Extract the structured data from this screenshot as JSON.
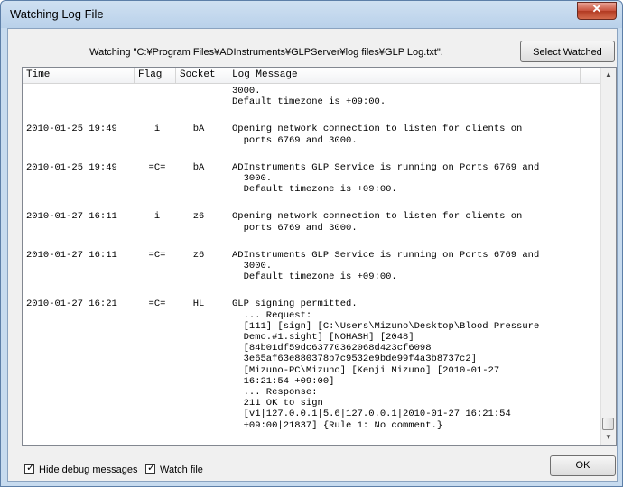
{
  "window": {
    "title": "Watching Log File",
    "close_glyph": "✕"
  },
  "watching_label": "Watching \"C:¥Program Files¥ADInstruments¥GLPServer¥log files¥GLP Log.txt\".",
  "select_button": "Select Watched File...",
  "columns": [
    "Time",
    "Flag",
    "Socket",
    "Log Message"
  ],
  "rows": [
    {
      "time": "",
      "flag": "",
      "socket": "",
      "message": [
        "3000.",
        "Default timezone is +09:00."
      ]
    },
    {
      "time": "2010-01-25 19:49",
      "flag": "i",
      "socket": "bA",
      "message": [
        "Opening network connection to listen for clients on",
        "  ports 6769 and 3000."
      ]
    },
    {
      "time": "2010-01-25 19:49",
      "flag": "=C=",
      "socket": "bA",
      "message": [
        "ADInstruments GLP Service is running on Ports 6769 and",
        "  3000.",
        "  Default timezone is +09:00."
      ]
    },
    {
      "time": "2010-01-27 16:11",
      "flag": "i",
      "socket": "z6",
      "message": [
        "Opening network connection to listen for clients on",
        "  ports 6769 and 3000."
      ]
    },
    {
      "time": "2010-01-27 16:11",
      "flag": "=C=",
      "socket": "z6",
      "message": [
        "ADInstruments GLP Service is running on Ports 6769 and",
        "  3000.",
        "  Default timezone is +09:00."
      ]
    },
    {
      "time": "2010-01-27 16:21",
      "flag": "=C=",
      "socket": "HL",
      "message": [
        "GLP signing permitted.",
        "  ... Request:",
        "  [111] [sign] [C:\\Users\\Mizuno\\Desktop\\Blood Pressure",
        "  Demo.#1.sight] [NOHASH] [2048]",
        "  [84b01df59dc63770362068d423cf6098",
        "  3e65af63e880378b7c9532e9bde99f4a3b8737c2]",
        "  [Mizuno-PC\\Mizuno] [Kenji Mizuno] [2010-01-27",
        "  16:21:54 +09:00]",
        "  ... Response:",
        "  211 OK to sign",
        "  [v1|127.0.0.1|5.6|127.0.0.1|2010-01-27 16:21:54",
        "  +09:00|21837] {Rule 1: No comment.}"
      ]
    }
  ],
  "footer": {
    "hide_debug_label": "Hide debug messages",
    "hide_debug_checked": true,
    "watch_file_label": "Watch file",
    "watch_file_checked": true,
    "ok_label": "OK"
  },
  "icons": {
    "check": "✓",
    "up": "▲",
    "down": "▼"
  }
}
